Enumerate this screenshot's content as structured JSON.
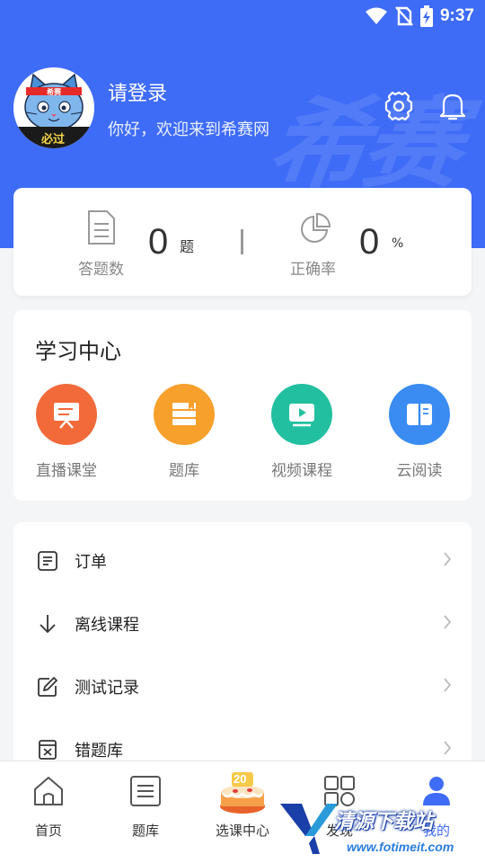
{
  "status_bar": {
    "time": "9:37",
    "icons": [
      "wifi-icon",
      "no-sim-icon",
      "battery-charging-icon"
    ]
  },
  "header": {
    "background_color": "#3f6cf6",
    "watermark_text": "希赛",
    "login_title": "请登录",
    "welcome_text": "你好，欢迎来到希赛网",
    "avatar": {
      "headband_text": "希赛",
      "badge_text": "必过"
    },
    "icons": [
      "settings-icon",
      "bell-icon"
    ]
  },
  "stats": {
    "answered": {
      "label": "答题数",
      "value": "0",
      "unit": "题",
      "icon": "document-icon"
    },
    "accuracy": {
      "label": "正确率",
      "value": "0",
      "unit": "%",
      "icon": "pie-chart-icon"
    }
  },
  "learning_center": {
    "title": "学习中心",
    "items": [
      {
        "label": "直播课堂",
        "icon": "presentation-icon",
        "color": "#f26a3a"
      },
      {
        "label": "题库",
        "icon": "books-icon",
        "color": "#f7a02c"
      },
      {
        "label": "视频课程",
        "icon": "video-play-icon",
        "color": "#22c0a0"
      },
      {
        "label": "云阅读",
        "icon": "open-book-icon",
        "color": "#3a8cf2"
      }
    ]
  },
  "menu": {
    "items": [
      {
        "label": "订单",
        "icon": "order-icon"
      },
      {
        "label": "离线课程",
        "icon": "download-arrow-icon"
      },
      {
        "label": "测试记录",
        "icon": "edit-icon"
      },
      {
        "label": "错题库",
        "icon": "wrong-questions-icon"
      }
    ]
  },
  "bottom_nav": {
    "items": [
      {
        "label": "首页",
        "icon": "home-icon",
        "active": false
      },
      {
        "label": "题库",
        "icon": "question-bank-icon",
        "active": false
      },
      {
        "label": "选课中心",
        "icon": "birthday-cake-icon",
        "active": false,
        "badge": "20"
      },
      {
        "label": "发现",
        "icon": "grid-icon",
        "active": false
      },
      {
        "label": "我的",
        "icon": "user-icon",
        "active": true
      }
    ]
  },
  "overlay_watermark": {
    "cn_text": "清源下载站",
    "en_text": "www.fotimeit.com"
  }
}
